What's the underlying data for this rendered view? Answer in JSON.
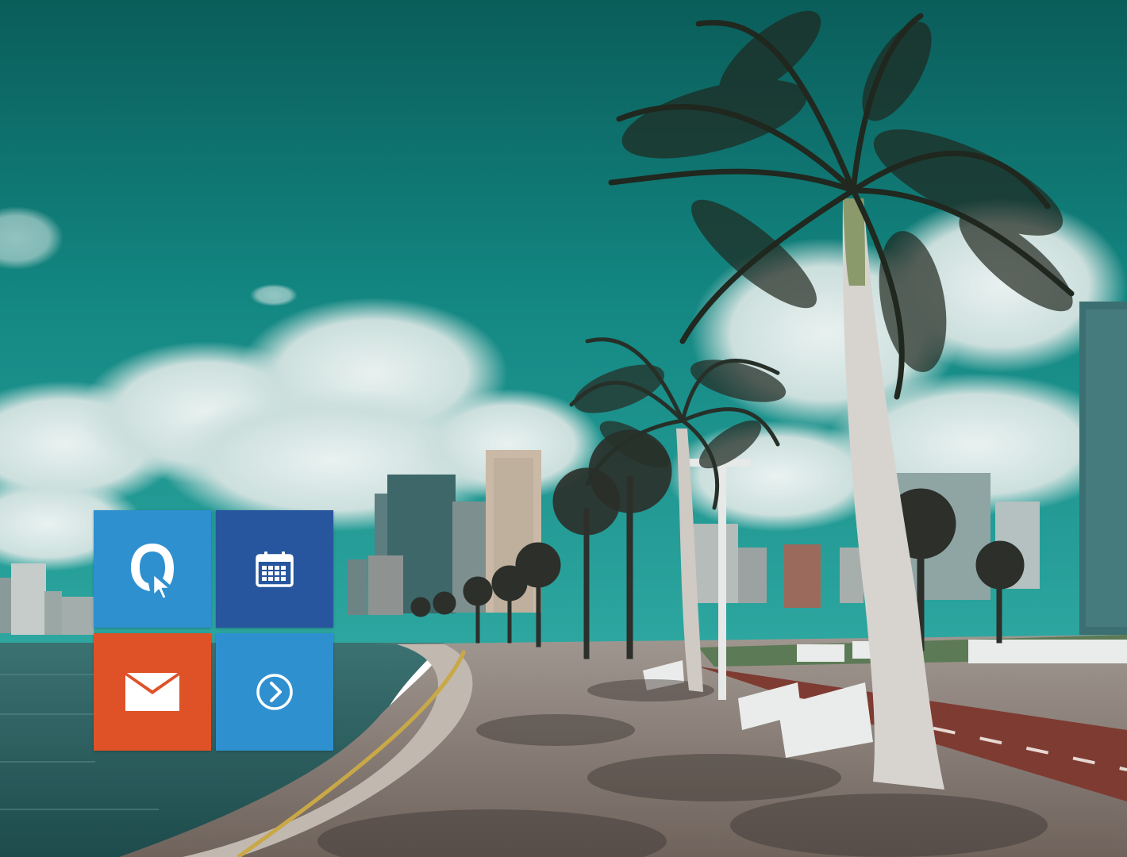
{
  "tiles": [
    {
      "name": "qa-app-tile",
      "icon": "q-logo-cursor-icon",
      "color": "#2f90d0"
    },
    {
      "name": "calendar-tile",
      "icon": "calendar-icon",
      "color": "#27569e"
    },
    {
      "name": "mail-tile",
      "icon": "envelope-icon",
      "color": "#df5228"
    },
    {
      "name": "next-tile",
      "icon": "chevron-right-circle-icon",
      "color": "#2f90d0"
    }
  ],
  "scene": {
    "sky_color": "#127f7a",
    "water_color": "#2b5f60",
    "walkway_color": "#8c7f77",
    "bike_lane_color": "#7e3b32"
  }
}
